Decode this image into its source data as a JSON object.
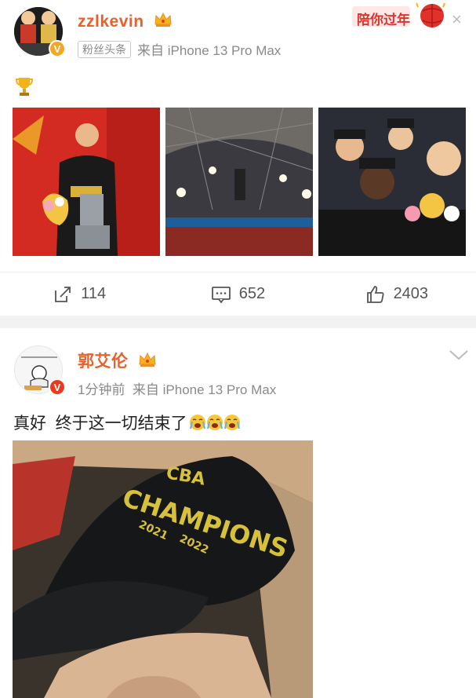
{
  "post1": {
    "username": "zzlkevin",
    "tag": "粉丝头条",
    "source": "来自 iPhone 13 Pro Max",
    "text_icon": "trophy-icon",
    "banner_text": "陪你过年",
    "actions": {
      "repost": "114",
      "comment": "652",
      "like": "2403"
    }
  },
  "post2": {
    "username": "郭艾伦",
    "time": "1分钟前",
    "source": "来自 iPhone 13 Pro Max",
    "text": "真好  终于这一切结束了",
    "cap_text_line1": "CBA",
    "cap_text_line2": "CHAMPIONS",
    "cap_year1": "2021",
    "cap_year2": "2022"
  },
  "colors": {
    "username": "#e8612c",
    "meta": "#8a8a8a",
    "separator": "#f2f2f2"
  }
}
